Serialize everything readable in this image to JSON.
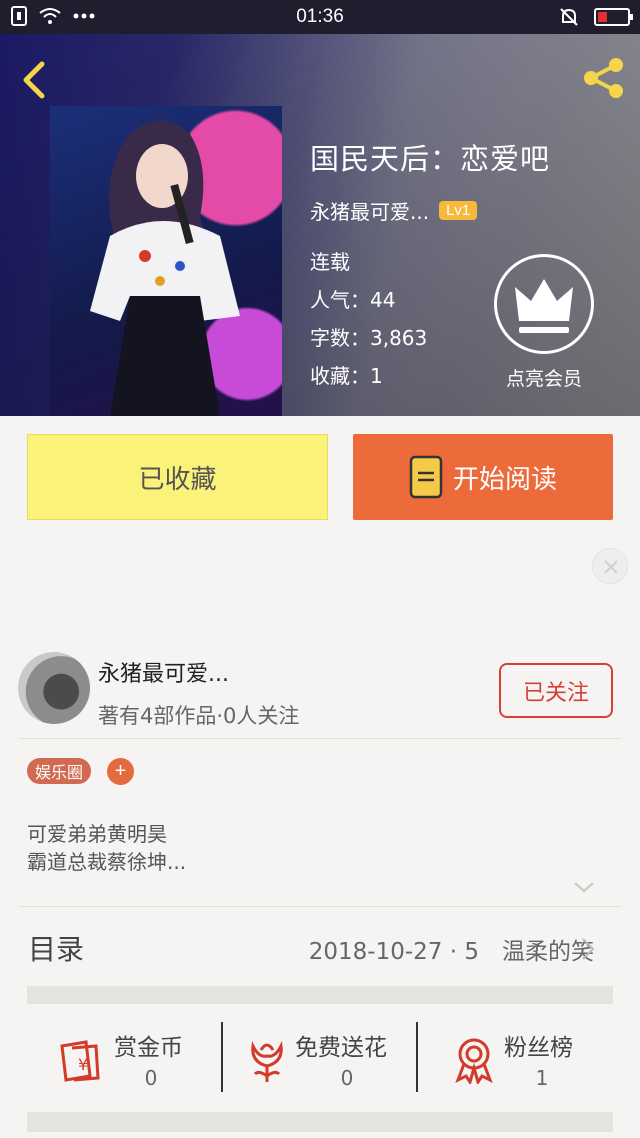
{
  "status_bar": {
    "time": "01:36"
  },
  "hero": {
    "title": "国民天后：恋爱吧",
    "author": "永猪最可爱...",
    "level": "Lv1",
    "state": "连载",
    "popularity": "人气：44",
    "word_count": "字数：3,863",
    "favorites": "收藏：1",
    "vip_label": "点亮会员"
  },
  "actions": {
    "favorited_label": "已收藏",
    "read_label": "开始阅读"
  },
  "author_card": {
    "name": "永猪最可爱...",
    "summary": "著有4部作品·0人关注",
    "follow_label": "已关注"
  },
  "tags": [
    {
      "label": "娱乐圈"
    }
  ],
  "tag_add": "+",
  "description": [
    "可爱弟弟黄明昊",
    "霸道总裁蔡徐坤..."
  ],
  "toc": {
    "label": "目录",
    "latest": "2018-10-27 · 5　温柔的笑"
  },
  "stats": [
    {
      "label": "赏金币",
      "value": "0",
      "icon": "red-envelope-icon"
    },
    {
      "label": "免费送花",
      "value": "0",
      "icon": "flower-icon"
    },
    {
      "label": "粉丝榜",
      "value": "1",
      "icon": "medal-icon"
    }
  ],
  "colors": {
    "accent": "#ed6a3b",
    "favorite_bg": "#fbf27a",
    "follow": "#d74036",
    "icon_red": "#d23a2a",
    "level": "#f6b93a"
  }
}
